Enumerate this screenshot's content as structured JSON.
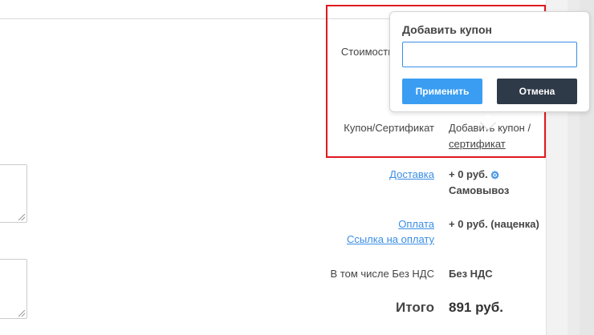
{
  "popover": {
    "title": "Добавить купон",
    "input_value": "",
    "apply_label": "Применить",
    "cancel_label": "Отмена"
  },
  "rows": {
    "cost_label": "Стоимость",
    "coupon_label": "Купон/Сертификат",
    "coupon_value_line1": "Добавить купон /",
    "coupon_value_link": "сертификат",
    "delivery_label": "Доставка",
    "delivery_value": "+ 0 руб.",
    "delivery_method": "Самовывоз",
    "payment_label": "Оплата",
    "payment_link_label": "Ссылка на оплату",
    "payment_value": "+ 0 руб. (наценка)",
    "vat_label": "В том числе Без НДС",
    "vat_value": "Без НДС",
    "total_label": "Итого",
    "total_value": "891 руб."
  },
  "icons": {
    "delivery_settings": "gear-icon"
  },
  "colors": {
    "link": "#3a8ee6",
    "apply_button": "#3a9df2",
    "cancel_button": "#2e3a48",
    "highlight_border": "#e0191f"
  }
}
